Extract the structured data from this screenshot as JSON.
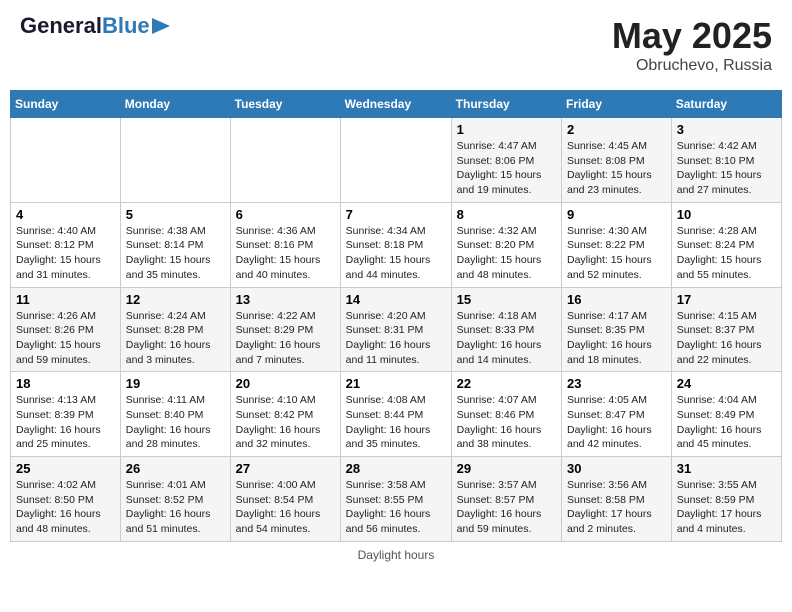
{
  "header": {
    "logo_line1": "General",
    "logo_line2": "Blue",
    "title": "May 2025",
    "subtitle": "Obruchevo, Russia"
  },
  "days_of_week": [
    "Sunday",
    "Monday",
    "Tuesday",
    "Wednesday",
    "Thursday",
    "Friday",
    "Saturday"
  ],
  "weeks": [
    [
      {
        "day": "",
        "info": ""
      },
      {
        "day": "",
        "info": ""
      },
      {
        "day": "",
        "info": ""
      },
      {
        "day": "",
        "info": ""
      },
      {
        "day": "1",
        "info": "Sunrise: 4:47 AM\nSunset: 8:06 PM\nDaylight: 15 hours\nand 19 minutes."
      },
      {
        "day": "2",
        "info": "Sunrise: 4:45 AM\nSunset: 8:08 PM\nDaylight: 15 hours\nand 23 minutes."
      },
      {
        "day": "3",
        "info": "Sunrise: 4:42 AM\nSunset: 8:10 PM\nDaylight: 15 hours\nand 27 minutes."
      }
    ],
    [
      {
        "day": "4",
        "info": "Sunrise: 4:40 AM\nSunset: 8:12 PM\nDaylight: 15 hours\nand 31 minutes."
      },
      {
        "day": "5",
        "info": "Sunrise: 4:38 AM\nSunset: 8:14 PM\nDaylight: 15 hours\nand 35 minutes."
      },
      {
        "day": "6",
        "info": "Sunrise: 4:36 AM\nSunset: 8:16 PM\nDaylight: 15 hours\nand 40 minutes."
      },
      {
        "day": "7",
        "info": "Sunrise: 4:34 AM\nSunset: 8:18 PM\nDaylight: 15 hours\nand 44 minutes."
      },
      {
        "day": "8",
        "info": "Sunrise: 4:32 AM\nSunset: 8:20 PM\nDaylight: 15 hours\nand 48 minutes."
      },
      {
        "day": "9",
        "info": "Sunrise: 4:30 AM\nSunset: 8:22 PM\nDaylight: 15 hours\nand 52 minutes."
      },
      {
        "day": "10",
        "info": "Sunrise: 4:28 AM\nSunset: 8:24 PM\nDaylight: 15 hours\nand 55 minutes."
      }
    ],
    [
      {
        "day": "11",
        "info": "Sunrise: 4:26 AM\nSunset: 8:26 PM\nDaylight: 15 hours\nand 59 minutes."
      },
      {
        "day": "12",
        "info": "Sunrise: 4:24 AM\nSunset: 8:28 PM\nDaylight: 16 hours\nand 3 minutes."
      },
      {
        "day": "13",
        "info": "Sunrise: 4:22 AM\nSunset: 8:29 PM\nDaylight: 16 hours\nand 7 minutes."
      },
      {
        "day": "14",
        "info": "Sunrise: 4:20 AM\nSunset: 8:31 PM\nDaylight: 16 hours\nand 11 minutes."
      },
      {
        "day": "15",
        "info": "Sunrise: 4:18 AM\nSunset: 8:33 PM\nDaylight: 16 hours\nand 14 minutes."
      },
      {
        "day": "16",
        "info": "Sunrise: 4:17 AM\nSunset: 8:35 PM\nDaylight: 16 hours\nand 18 minutes."
      },
      {
        "day": "17",
        "info": "Sunrise: 4:15 AM\nSunset: 8:37 PM\nDaylight: 16 hours\nand 22 minutes."
      }
    ],
    [
      {
        "day": "18",
        "info": "Sunrise: 4:13 AM\nSunset: 8:39 PM\nDaylight: 16 hours\nand 25 minutes."
      },
      {
        "day": "19",
        "info": "Sunrise: 4:11 AM\nSunset: 8:40 PM\nDaylight: 16 hours\nand 28 minutes."
      },
      {
        "day": "20",
        "info": "Sunrise: 4:10 AM\nSunset: 8:42 PM\nDaylight: 16 hours\nand 32 minutes."
      },
      {
        "day": "21",
        "info": "Sunrise: 4:08 AM\nSunset: 8:44 PM\nDaylight: 16 hours\nand 35 minutes."
      },
      {
        "day": "22",
        "info": "Sunrise: 4:07 AM\nSunset: 8:46 PM\nDaylight: 16 hours\nand 38 minutes."
      },
      {
        "day": "23",
        "info": "Sunrise: 4:05 AM\nSunset: 8:47 PM\nDaylight: 16 hours\nand 42 minutes."
      },
      {
        "day": "24",
        "info": "Sunrise: 4:04 AM\nSunset: 8:49 PM\nDaylight: 16 hours\nand 45 minutes."
      }
    ],
    [
      {
        "day": "25",
        "info": "Sunrise: 4:02 AM\nSunset: 8:50 PM\nDaylight: 16 hours\nand 48 minutes."
      },
      {
        "day": "26",
        "info": "Sunrise: 4:01 AM\nSunset: 8:52 PM\nDaylight: 16 hours\nand 51 minutes."
      },
      {
        "day": "27",
        "info": "Sunrise: 4:00 AM\nSunset: 8:54 PM\nDaylight: 16 hours\nand 54 minutes."
      },
      {
        "day": "28",
        "info": "Sunrise: 3:58 AM\nSunset: 8:55 PM\nDaylight: 16 hours\nand 56 minutes."
      },
      {
        "day": "29",
        "info": "Sunrise: 3:57 AM\nSunset: 8:57 PM\nDaylight: 16 hours\nand 59 minutes."
      },
      {
        "day": "30",
        "info": "Sunrise: 3:56 AM\nSunset: 8:58 PM\nDaylight: 17 hours\nand 2 minutes."
      },
      {
        "day": "31",
        "info": "Sunrise: 3:55 AM\nSunset: 8:59 PM\nDaylight: 17 hours\nand 4 minutes."
      }
    ]
  ],
  "footer": {
    "note": "Daylight hours"
  }
}
